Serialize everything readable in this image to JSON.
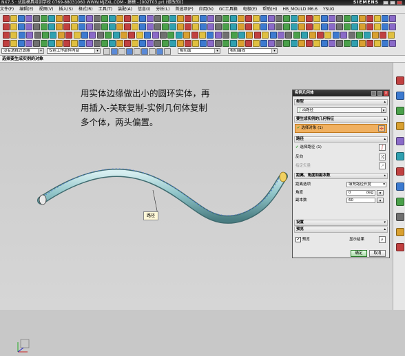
{
  "window": {
    "title": "NX7.5 · 优胜模具培训学校  0769-88031060  WWW.MJZXL.COM - 建模 - [002T03.prt (修改的)]",
    "brand": "SIEMENS"
  },
  "menu": [
    "文件(F)",
    "编辑(E)",
    "视图(V)",
    "插入(S)",
    "格式(R)",
    "工具(T)",
    "装配(A)",
    "信息(I)",
    "分析(L)",
    "首选项(P)",
    "应用(N)",
    "GC工具箱",
    "电极(E)",
    "帮助(H)",
    "HB_MOULD M6.6",
    "YSUG"
  ],
  "selection_bar": {
    "filter": "没有选择过滤器",
    "scope": "仅在工作部件内部",
    "snap": "相切面",
    "curve_rule": "相切曲线"
  },
  "cue_line": "选择要生成实例的对象",
  "annotation": [
    "用实体边缘做出小的圆环实体，再",
    "用插入-关联复制-实例几何体复制",
    "多个体，两头偏置。"
  ],
  "viewport_label": "路径",
  "dialog": {
    "title": "实例几何体",
    "type_section": "类型",
    "type_value": "沿路径",
    "objects_section": "要生成实例的几何特征",
    "select_object": "选择对象 (1)",
    "path_section": "路径",
    "select_path": "选择路径 (1)",
    "reverse": "反向",
    "specify_vector": "指定矢量",
    "distance_section": "距离、角度和副本数",
    "distance_option_label": "距离选项",
    "distance_option_value": "填充路径长度",
    "angle_label": "角度",
    "angle_value": "0",
    "angle_unit": "deg",
    "copies_label": "副本数",
    "copies_value": "60",
    "settings_section": "设置",
    "preview_section": "预览",
    "preview_checkbox": "预览",
    "show_result": "显示结果",
    "ok": "确定",
    "cancel": "取消"
  },
  "colors": {
    "accent_green": "#2a9a2a",
    "dialog_title": "#2c2c2c",
    "selected_row": "#f0b060",
    "tube": "#8fc4c8"
  }
}
